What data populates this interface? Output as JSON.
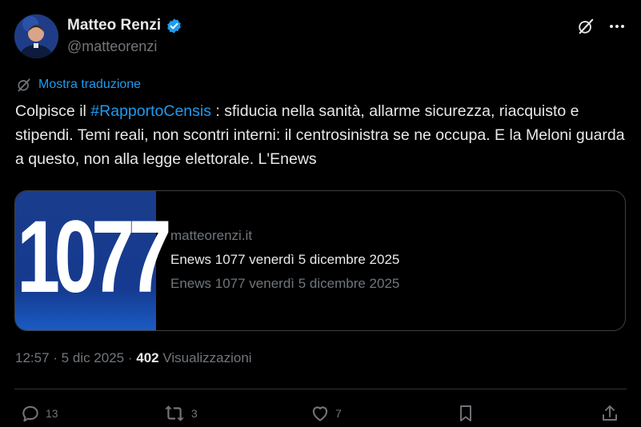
{
  "author": {
    "name": "Matteo Renzi",
    "handle": "@matteorenzi"
  },
  "translate_label": "Mostra traduzione",
  "post": {
    "part1": "Colpisce il ",
    "hashtag": "#RapportoCensis",
    "part2": " : sfiducia nella sanità, allarme sicurezza, riacquisto e stipendi. Temi reali, non scontri interni: il centrosinistra se ne occupa. E la Meloni guarda a questo, non alla legge elettorale. L'Enews"
  },
  "card": {
    "image_text": "1077",
    "domain": "matteorenzi.it",
    "title": "Enews 1077 venerdì 5 dicembre 2025",
    "description": "Enews 1077 venerdì 5 dicembre 2025"
  },
  "meta": {
    "time": "12:57",
    "date": "5 dic 2025",
    "views_count": "402",
    "views_label": "Visualizzazioni"
  },
  "actions": {
    "replies": "13",
    "reposts": "3",
    "likes": "7"
  },
  "colors": {
    "accent": "#1d9bf0",
    "muted": "#71767b",
    "text": "#e7e9ea",
    "background": "#000000"
  }
}
